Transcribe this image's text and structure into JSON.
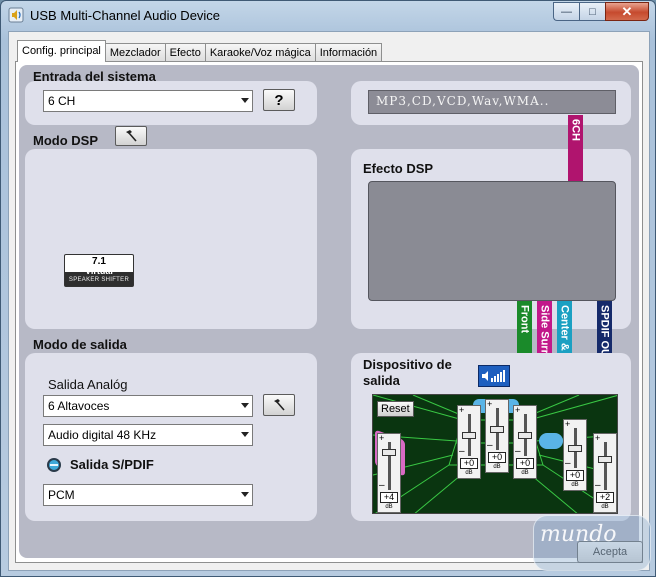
{
  "window": {
    "title": "USB Multi-Channel Audio Device",
    "controls": {
      "minimize": "—",
      "maximize": "□",
      "close": "✕"
    }
  },
  "tabs": [
    {
      "label": "Config. principal",
      "active": true
    },
    {
      "label": "Mezclador",
      "active": false
    },
    {
      "label": "Efecto",
      "active": false
    },
    {
      "label": "Karaoke/Voz mágica",
      "active": false
    },
    {
      "label": "Información",
      "active": false
    }
  ],
  "entrada": {
    "heading": "Entrada del sistema",
    "select_value": "6 CH",
    "help_label": "?",
    "display_text": "MP3,CD,VCD,Wav,WMA.."
  },
  "dsp": {
    "heading": "Modo DSP",
    "badge": {
      "number": "7.1",
      "line1": "Virtual",
      "line2": "SPEAKER SHIFTER"
    },
    "effect_heading": "Efecto DSP"
  },
  "channels": {
    "top": "6CH",
    "front": "Front",
    "side": "Side Surround",
    "center": "Center & Sub",
    "spdif": "SPDIF OUT",
    "colors": {
      "top": "#b0146e",
      "front": "#1a8a2a",
      "side": "#c2188a",
      "center": "#1ba0c2",
      "spdif": "#152a6a"
    }
  },
  "salida": {
    "heading": "Modo de salida",
    "analog_label": "Salida Analóg",
    "speakers_value": "6 Altavoces",
    "digital_value": "Audio digital  48 KHz",
    "spdif_label": "Salida S/PDIF",
    "spdif_value": "PCM"
  },
  "dispositivo": {
    "heading_line1": "Dispositivo de",
    "heading_line2": "salida",
    "reset_label": "Reset",
    "faders": [
      {
        "name": "front-left",
        "value": "+4",
        "level": 0.18
      },
      {
        "name": "center",
        "value": "+0",
        "level": 0.5
      },
      {
        "name": "subwoofer",
        "value": "+0",
        "level": 0.5
      },
      {
        "name": "front-right",
        "value": "+0",
        "level": 0.5
      },
      {
        "name": "surround-left",
        "value": "+0",
        "level": 0.5
      },
      {
        "name": "surround-right",
        "value": "+2",
        "level": 0.33
      }
    ],
    "db_label": "dB",
    "plus": "+",
    "minus": "–"
  },
  "footer": {
    "accept_label": "Acepta",
    "watermark": "mundo"
  }
}
